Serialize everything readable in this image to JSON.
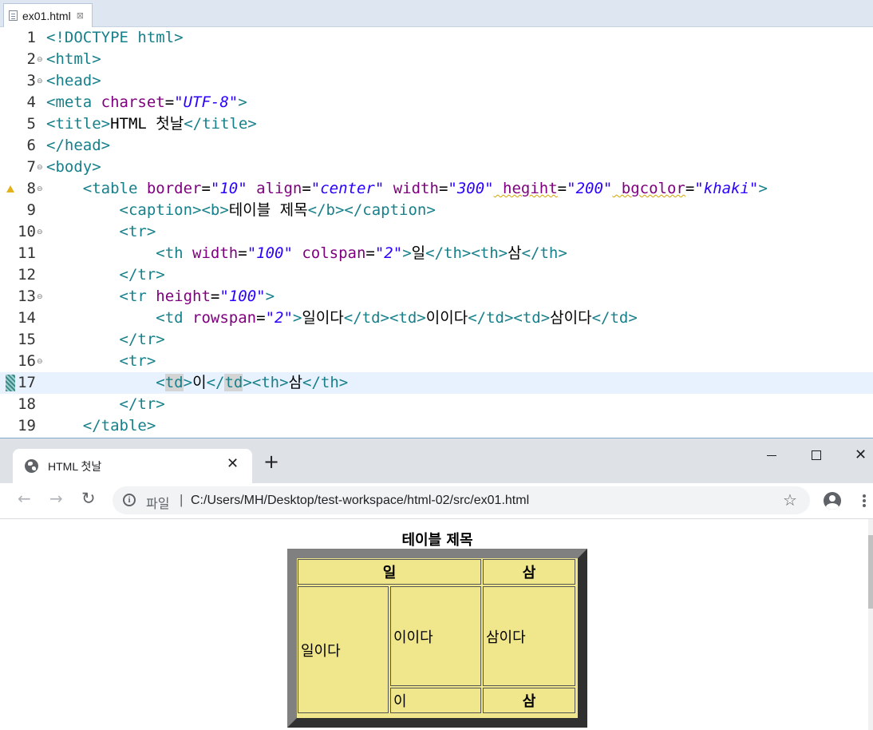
{
  "editor": {
    "tab_label": "ex01.html",
    "tab_close": "⊠"
  },
  "lines": {
    "n1": "1",
    "n2": "2",
    "n3": "3",
    "n4": "4",
    "n5": "5",
    "n6": "6",
    "n7": "7",
    "n8": "8",
    "n9": "9",
    "n10": "10",
    "n11": "11",
    "n12": "12",
    "n13": "13",
    "n14": "14",
    "n15": "15",
    "n16": "16",
    "n17": "17",
    "n18": "18",
    "n19": "19"
  },
  "code": {
    "l1_doctype": "<!DOCTYPE",
    "l1_html": " html>",
    "l2": "<html>",
    "l3": "<head>",
    "l4_open": "<meta",
    "l4_attr": " charset",
    "l4_eq": "=",
    "l4_val": "\"UTF-8\"",
    "l4_close": ">",
    "l5_open": "<title>",
    "l5_text": "HTML 첫날",
    "l5_close": "</title>",
    "l6": "</head>",
    "l7": "<body>",
    "l8_open": "    <table",
    "l8_a1": " border",
    "l8_v1": "\"10\"",
    "l8_a2": " align",
    "l8_v2": "\"center\"",
    "l8_a3": " width",
    "l8_v3": "\"300\"",
    "l8_a4": " hegiht",
    "l8_v4": "\"200\"",
    "l8_a5": " bgcolor",
    "l8_v5": "\"khaki\"",
    "l8_close": ">",
    "l9_open": "        <caption><b>",
    "l9_text": "테이블 제목",
    "l9_close": "</b></caption>",
    "l10": "        <tr>",
    "l11_open": "            <th",
    "l11_a1": " width",
    "l11_v1": "\"100\"",
    "l11_a2": " colspan",
    "l11_v2": "\"2\"",
    "l11_gt": ">",
    "l11_t1": "일",
    "l11_mid": "</th><th>",
    "l11_t2": "삼",
    "l11_end": "</th>",
    "l12": "        </tr>",
    "l13_open": "        <tr",
    "l13_a1": " height",
    "l13_v1": "\"100\"",
    "l13_close": ">",
    "l14_open": "            <td",
    "l14_a1": " rowspan",
    "l14_v1": "\"2\"",
    "l14_gt": ">",
    "l14_t1": "일이다",
    "l14_m1": "</td><td>",
    "l14_t2": "이이다",
    "l14_m2": "</td><td>",
    "l14_t3": "삼이다",
    "l14_end": "</td>",
    "l15": "        </tr>",
    "l16": "        <tr>",
    "l17_indent": "            ",
    "l17_lt": "<",
    "l17_td": "td",
    "l17_gt": ">",
    "l17_t1": "이",
    "l17_lt2": "</",
    "l17_td2": "td",
    "l17_m": "><th>",
    "l17_t2": "삼",
    "l17_end": "</th>",
    "l18": "        </tr>",
    "l19": "    </table>"
  },
  "browser": {
    "tab_title": "HTML 첫날",
    "tab_close": "✕",
    "new_tab": "+",
    "win_close": "✕",
    "back": "←",
    "forward": "→",
    "reload": "↻",
    "info": "i",
    "scheme_label": "파일",
    "separator": "|",
    "url": "C:/Users/MH/Desktop/test-workspace/html-02/src/ex01.html",
    "star": "☆"
  },
  "page": {
    "caption": "테이블 제목",
    "th_1": "일",
    "th_2": "삼",
    "td_1": "일이다",
    "td_2": "이이다",
    "td_3": "삼이다",
    "td_4": "이",
    "th_3": "삼",
    "bgcolor": "#f0e68c"
  },
  "icons": {
    "file": "file-icon",
    "globe": "globe-icon",
    "info": "info-icon",
    "star": "star-icon",
    "profile": "profile-icon",
    "menu": "menu-icon"
  }
}
